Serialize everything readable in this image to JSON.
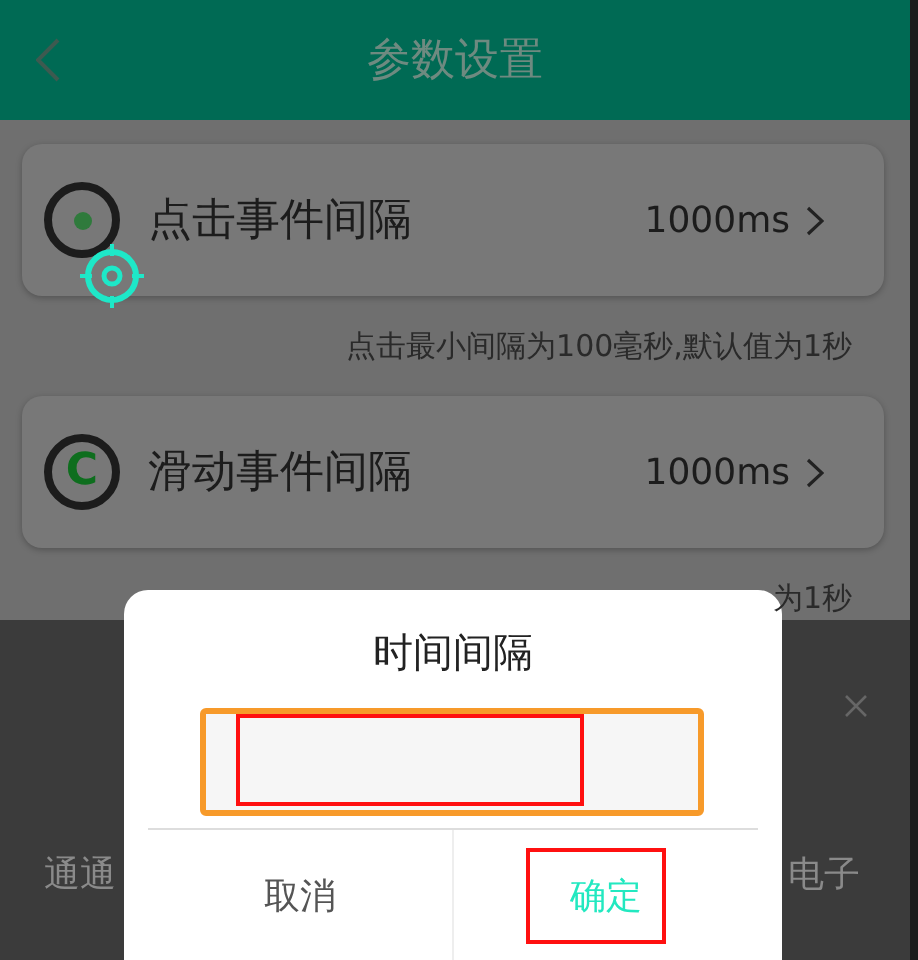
{
  "header": {
    "title": "参数设置"
  },
  "settings": [
    {
      "kind": "dot",
      "title": "点击事件间隔",
      "value": "1000ms",
      "hint": "点击最小间隔为100毫秒,默认值为1秒"
    },
    {
      "kind": "letter",
      "letter": "C",
      "title": "滑动事件间隔",
      "value": "1000ms",
      "hint": "为1秒"
    }
  ],
  "background_panel": {
    "left_text": "通通",
    "right_text": "电子"
  },
  "dialog": {
    "title": "时间间隔",
    "buttons": [
      {
        "label": "取消",
        "primary": false
      },
      {
        "label": "确定",
        "primary": true
      }
    ]
  }
}
